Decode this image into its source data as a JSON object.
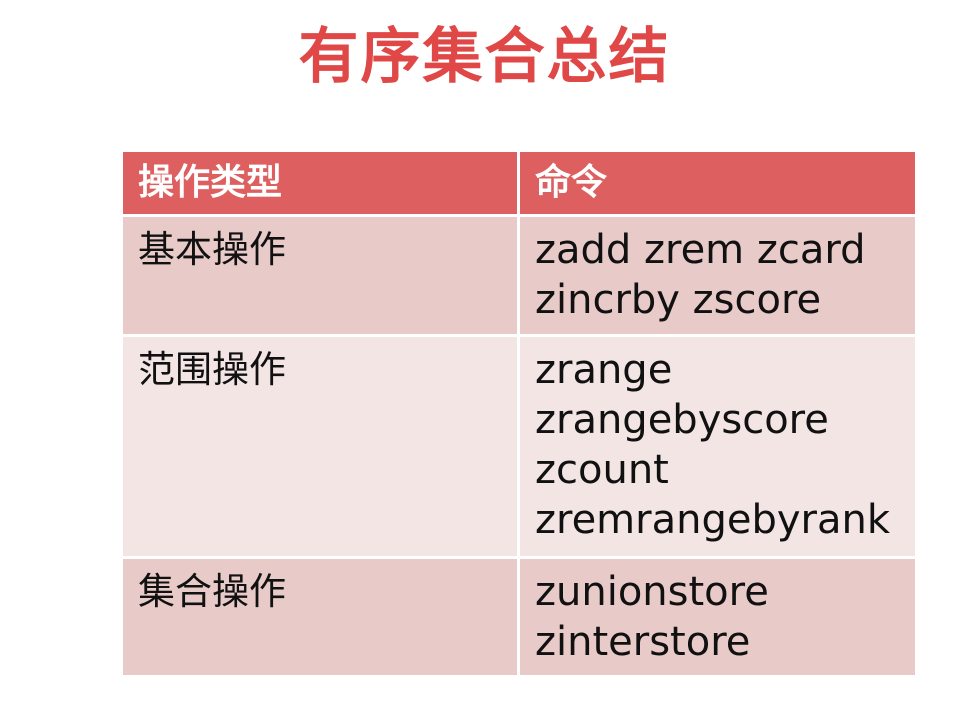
{
  "title": "有序集合总结",
  "table": {
    "headers": [
      "操作类型",
      "命令"
    ],
    "rows": [
      {
        "type": "基本操作",
        "commands": [
          "zadd zrem zcard",
          "zincrby zscore"
        ]
      },
      {
        "type": "范围操作",
        "commands": [
          "zrange",
          "zrangebyscore",
          "zcount",
          "zremrangebyrank"
        ]
      },
      {
        "type": "集合操作",
        "commands": [
          "zunionstore",
          "zinterstore"
        ]
      }
    ]
  }
}
